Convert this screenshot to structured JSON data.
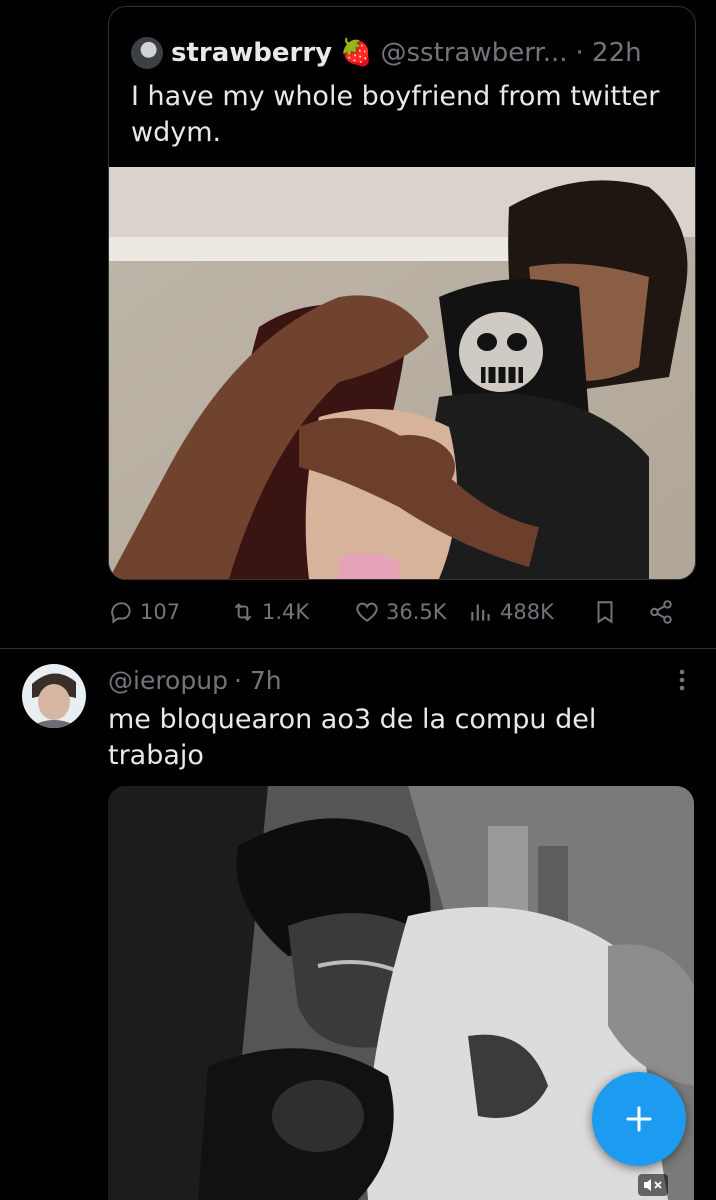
{
  "quoted_tweet": {
    "display_name": "strawberry",
    "emoji": "🍓",
    "handle": "@sstrawberr...",
    "time": "· 22h",
    "text": "I have my whole boyfriend from twitter wdym."
  },
  "actions": {
    "replies": "107",
    "reposts": "1.4K",
    "likes": "36.5K",
    "views": "488K"
  },
  "tweet2": {
    "handle": "@ieropup",
    "time": "· 7h",
    "text": "me bloquearon ao3 de la compu del trabajo"
  },
  "icons": [
    "verified-avatar",
    "reply-icon",
    "repost-icon",
    "like-icon",
    "views-icon",
    "bookmark-icon",
    "share-icon",
    "more-icon",
    "compose-plus-icon",
    "mute-icon"
  ],
  "colors": {
    "background": "#000000",
    "muted": "#71767b",
    "text": "#e7e9ea",
    "accent": "#1d9bf0",
    "border": "#2f3336"
  }
}
